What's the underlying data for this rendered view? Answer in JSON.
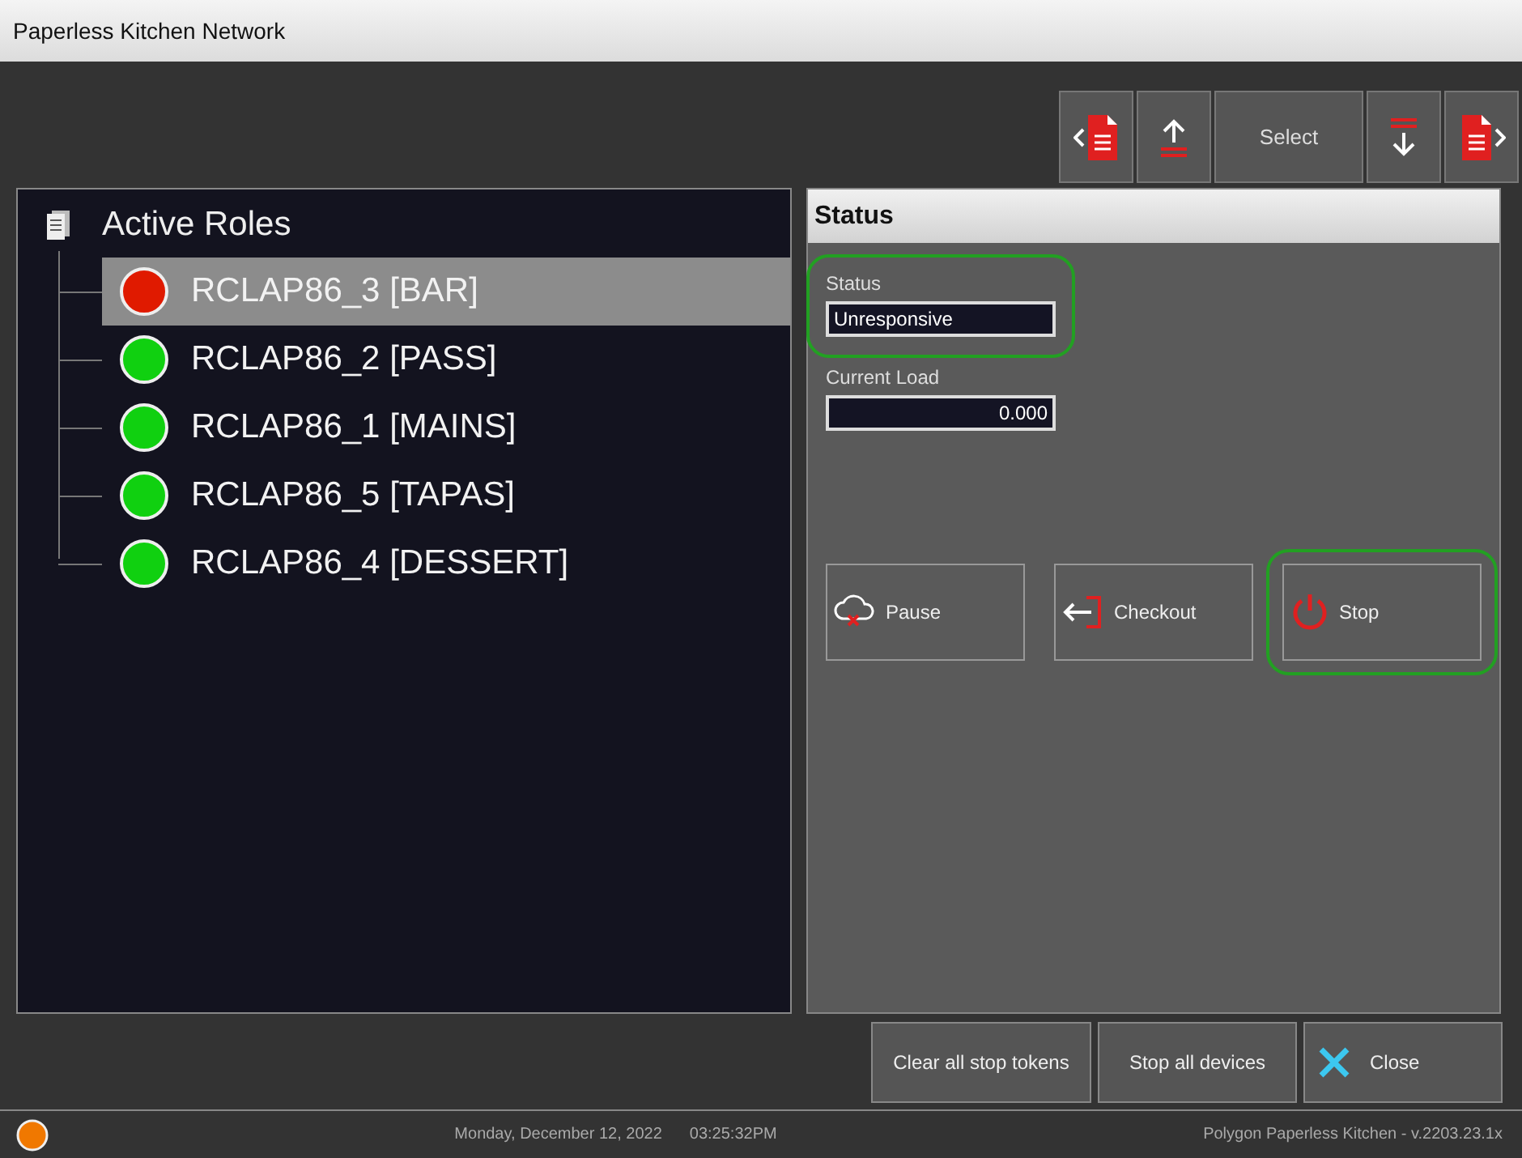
{
  "window": {
    "title": "Paperless Kitchen Network"
  },
  "toolbar": [
    {
      "kind": "prev-doc"
    },
    {
      "kind": "move-up"
    },
    {
      "kind": "text",
      "label": "Select"
    },
    {
      "kind": "move-down"
    },
    {
      "kind": "next-doc"
    }
  ],
  "roles_panel": {
    "title": "Active Roles",
    "items": [
      {
        "label": "RCLAP86_3 [BAR]",
        "color": "#e01a00",
        "selected": true
      },
      {
        "label": "RCLAP86_2 [PASS]",
        "color": "#10d010",
        "selected": false
      },
      {
        "label": "RCLAP86_1 [MAINS]",
        "color": "#10d010",
        "selected": false
      },
      {
        "label": "RCLAP86_5 [TAPAS]",
        "color": "#10d010",
        "selected": false
      },
      {
        "label": "RCLAP86_4 [DESSERT]",
        "color": "#10d010",
        "selected": false
      }
    ]
  },
  "status_panel": {
    "title": "Status",
    "fields": [
      {
        "kind": "text",
        "label": "Status",
        "value": "Unresponsive",
        "highlighted": true
      },
      {
        "kind": "number",
        "label": "Current Load",
        "value": "0.000",
        "highlighted": false
      }
    ],
    "actions": [
      {
        "kind": "pause",
        "label": "Pause",
        "highlighted": false
      },
      {
        "kind": "checkout",
        "label": "Checkout",
        "highlighted": false
      },
      {
        "kind": "stop",
        "label": "Stop",
        "highlighted": true
      }
    ]
  },
  "footer_buttons": [
    {
      "kind": "text",
      "label": "Clear all stop tokens"
    },
    {
      "kind": "text",
      "label": "Stop all devices"
    },
    {
      "kind": "close",
      "label": "Close"
    }
  ],
  "status_bar": {
    "date": "Monday, December 12, 2022",
    "time": "03:25:32PM",
    "version": "Polygon Paperless Kitchen - v.2203.23.1x"
  }
}
